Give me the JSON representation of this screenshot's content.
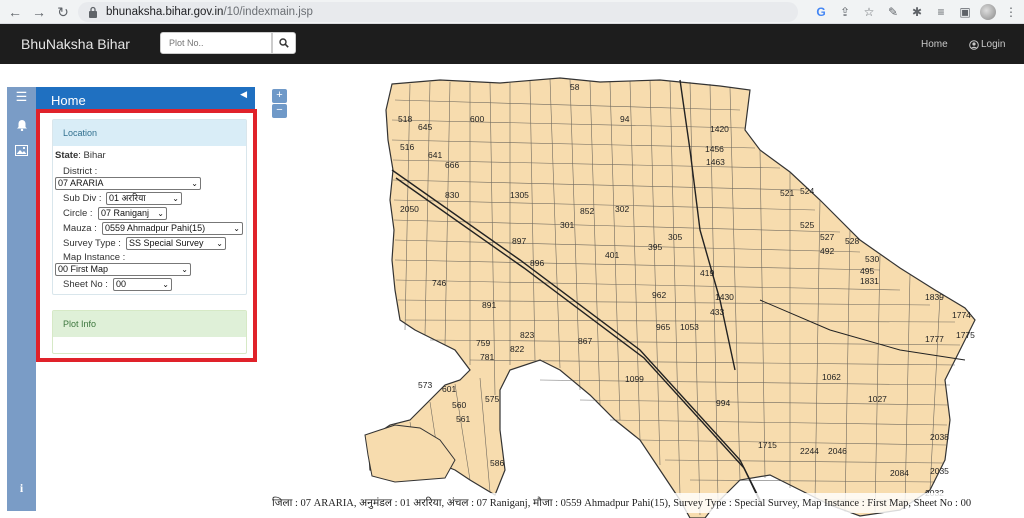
{
  "browser": {
    "url_host": "bhunaksha.bihar.gov.in",
    "url_path": "/10/indexmain.jsp"
  },
  "navbar": {
    "brand": "BhuNaksha Bihar",
    "search_placeholder": "Plot No..",
    "home": "Home",
    "login": "Login"
  },
  "panel": {
    "title": "Home",
    "location": {
      "heading": "Location",
      "state_label": "State",
      "state_value": ": Bihar",
      "district_label": "District :",
      "district_value": "07 ARARIA",
      "subdiv_label": "Sub Div :",
      "subdiv_value": "01 अररिया",
      "circle_label": "Circle :",
      "circle_value": "07 Raniganj",
      "mauza_label": "Mauza :",
      "mauza_value": "0559 Ahmadpur Pahi(15)",
      "survey_label": "Survey Type :",
      "survey_value": "SS Special Survey",
      "map_instance_label": "Map Instance :",
      "map_instance_value": "00 First Map",
      "sheet_label": "Sheet No :",
      "sheet_value": "00"
    },
    "plot_info": {
      "heading": "Plot Info"
    }
  },
  "zoom": {
    "in": "+",
    "out": "−"
  },
  "status_line": "जिला : 07 ARARIA, अनुमंडल : 01 अररिया, अंचल : 07 Raniganj, मौजा : 0559 Ahmadpur Pahi(15), Survey Type : Special Survey, Map Instance : First Map, Sheet No : 00",
  "map": {
    "fill_color": "#f7dcae",
    "line_color": "#3a3a3a",
    "plot_labels": [
      "518",
      "645",
      "516",
      "641",
      "666",
      "600",
      "58",
      "94",
      "1420",
      "1456",
      "1463",
      "830",
      "2050",
      "1305",
      "852",
      "301",
      "302",
      "521",
      "524",
      "525",
      "527",
      "528",
      "530",
      "896",
      "897",
      "401",
      "395",
      "305",
      "419",
      "433",
      "492",
      "495",
      "746",
      "891",
      "962",
      "965",
      "1053",
      "1430",
      "1831",
      "1839",
      "1774",
      "1775",
      "1777",
      "759",
      "781",
      "822",
      "823",
      "867",
      "1099",
      "1062",
      "1027",
      "994",
      "573",
      "601",
      "560",
      "575",
      "561",
      "549",
      "555",
      "586",
      "1715",
      "2244",
      "2046",
      "2038",
      "2084",
      "2035",
      "2032"
    ]
  },
  "colors": {
    "panel_head": "#1f70c1",
    "rail": "#7a9cc6",
    "highlight": "#e0222a",
    "navbar": "#1d1d1d"
  }
}
